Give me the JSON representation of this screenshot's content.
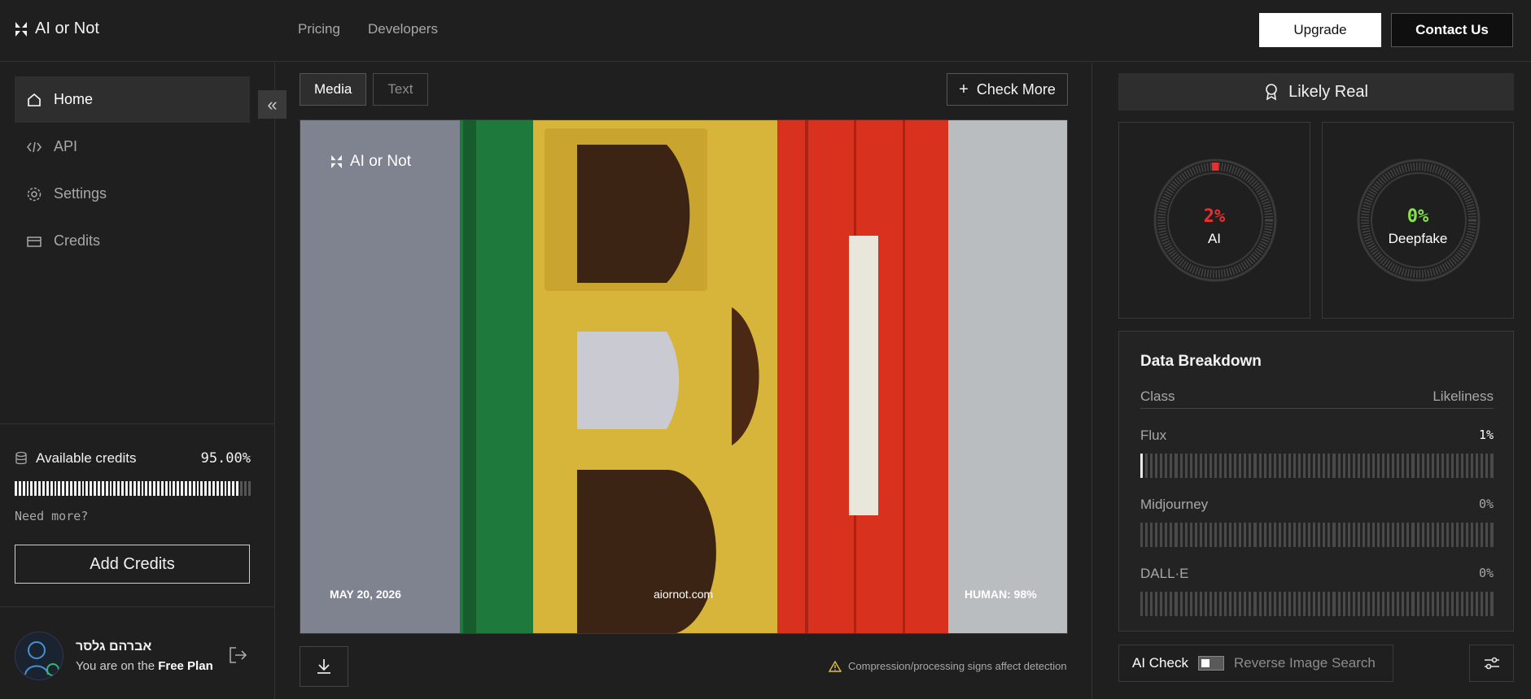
{
  "app": {
    "name": "AI or Not"
  },
  "topnav": {
    "items": [
      "Pricing",
      "Developers"
    ],
    "upgrade_label": "Upgrade",
    "contact_label": "Contact Us"
  },
  "sidebar": {
    "items": [
      {
        "label": "Home",
        "icon": "home-icon",
        "active": true
      },
      {
        "label": "API",
        "icon": "code-icon"
      },
      {
        "label": "Settings",
        "icon": "gear-icon"
      },
      {
        "label": "Credits",
        "icon": "card-icon"
      }
    ],
    "credits": {
      "label": "Available credits",
      "value": "95.00%",
      "level": 0.95,
      "need_more": "Need more?",
      "add_label": "Add Credits"
    },
    "user": {
      "name": "אברהם גלסר",
      "plan_prefix": "You are on the",
      "plan": "Free Plan"
    }
  },
  "main": {
    "tabs": [
      {
        "label": "Media",
        "active": true
      },
      {
        "label": "Text",
        "active": false
      }
    ],
    "check_more_label": "Check More",
    "overlay": {
      "logo": "AI or Not",
      "date_prefix": "MAY",
      "date_rest": "20, 2026",
      "site": "aiornot.com",
      "human": "HUMAN: 98%"
    },
    "warning": "Compression/processing signs affect detection"
  },
  "result": {
    "verdict": "Likely Real",
    "gauges": [
      {
        "value": "2%",
        "label": "AI",
        "color": "#e8312f",
        "level": 0.02
      },
      {
        "value": "0%",
        "label": "Deepfake",
        "color": "#86e34a",
        "level": 0.0
      }
    ],
    "breakdown": {
      "title": "Data Breakdown",
      "col_class": "Class",
      "col_likeliness": "Likeliness",
      "rows": [
        {
          "name": "Flux",
          "value": "1%",
          "level": 0.01
        },
        {
          "name": "Midjourney",
          "value": "0%",
          "level": 0.0
        },
        {
          "name": "DALL·E",
          "value": "0%",
          "level": 0.0
        }
      ]
    },
    "ai_check_label": "AI Check",
    "reverse_label": "Reverse Image Search"
  }
}
